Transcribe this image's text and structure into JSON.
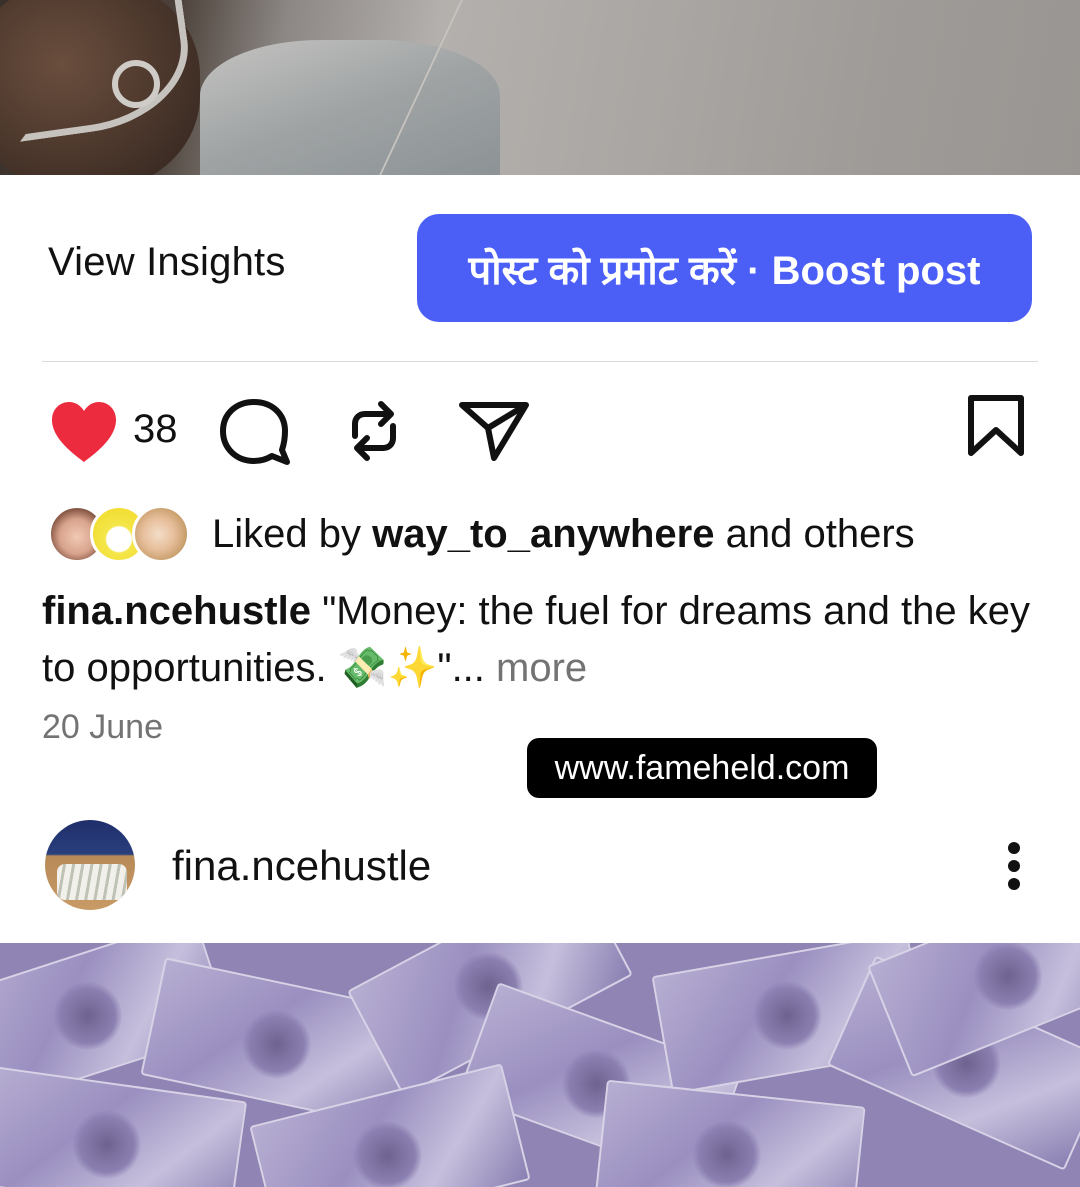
{
  "post_actions": {
    "view_insights_label": "View Insights",
    "boost_label": "पोस्ट को प्रमोट करें · Boost post"
  },
  "engagement": {
    "like_count": "38",
    "icons": [
      "heart-filled-icon",
      "comment-icon",
      "repost-icon",
      "share-icon",
      "bookmark-icon"
    ],
    "heart_color": "#ED2B3F"
  },
  "liked_by": {
    "prefix": "Liked by ",
    "user": "way_to_anywhere",
    "suffix": " and others"
  },
  "caption": {
    "username": "fina.ncehustle",
    "text": " \"Money: the fuel for dreams and the key to opportunities. 💸✨\"",
    "ellipsis": "...",
    "more_label": " more"
  },
  "date": "20 June",
  "watermark": "www.fameheld.com",
  "next_post": {
    "username": "fina.ncehustle"
  },
  "colors": {
    "accent": "#4B5FF7",
    "secondary_text": "#737373"
  }
}
